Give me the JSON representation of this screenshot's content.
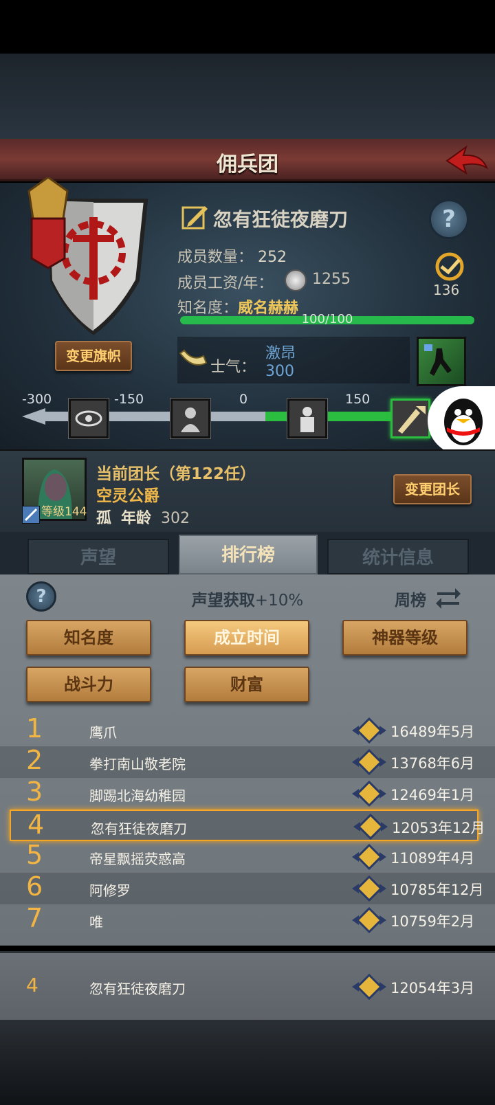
{
  "header": {
    "title": "佣兵团"
  },
  "guild": {
    "name": "忽有狂徒夜磨刀",
    "member_label": "成员数量：",
    "member_count": "252",
    "wage_label": "成员工资/年：",
    "wage": "1255",
    "fame_label": "知名度：",
    "fame_value": "威名赫赫",
    "fame_progress_text": "100/100",
    "fame_progress": 1.0,
    "badge_count": "136",
    "change_flag_label": "变更旗帜",
    "morale_label": "士气：",
    "morale_state": "激昂",
    "morale_value": "300"
  },
  "morale_scale": {
    "ticks": [
      "-300",
      "-150",
      "0",
      "150"
    ],
    "level": 0.83
  },
  "leader": {
    "title": "当前团长（第122任）",
    "name": "空灵公爵",
    "level_label": "等级",
    "level": "144",
    "trait": "孤",
    "age_label": "年龄",
    "age": "302",
    "change_leader_label": "变更团长"
  },
  "tabs": [
    {
      "label": "声望",
      "active": false
    },
    {
      "label": "排行榜",
      "active": true
    },
    {
      "label": "统计信息",
      "active": false
    }
  ],
  "ranking": {
    "bonus_label": "声望获取",
    "bonus_value": "+10%",
    "period_label": "周榜",
    "filters": [
      "知名度",
      "成立时间",
      "神器等级",
      "战斗力",
      "财富"
    ],
    "selected_filter": "成立时间",
    "rows": [
      {
        "rank": "1",
        "name": "鹰爪",
        "value": "16489年5月"
      },
      {
        "rank": "2",
        "name": "拳打南山敬老院",
        "value": "13768年6月"
      },
      {
        "rank": "3",
        "name": "脚踢北海幼稚园",
        "value": "12469年1月"
      },
      {
        "rank": "4",
        "name": "忽有狂徒夜磨刀",
        "value": "12053年12月"
      },
      {
        "rank": "5",
        "name": "帝星飘摇荧惑高",
        "value": "11089年4月"
      },
      {
        "rank": "6",
        "name": "阿修罗",
        "value": "10785年12月"
      },
      {
        "rank": "7",
        "name": "唯",
        "value": "10759年2月"
      }
    ],
    "highlight_index": 3,
    "my_row": {
      "rank": "4",
      "name": "忽有狂徒夜磨刀",
      "value": "12054年3月"
    }
  },
  "colors": {
    "accent": "#f2b544",
    "progress": "#27b94b",
    "title_bar": "#7a3a34"
  }
}
